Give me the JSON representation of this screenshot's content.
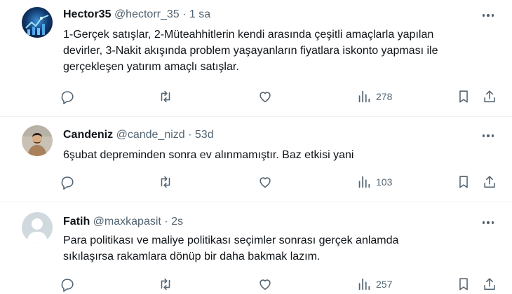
{
  "tweets": [
    {
      "name": "Hector35",
      "handle": "@hectorr_35",
      "separator": "·",
      "time": "1 sa",
      "lines": [
        "1-Gerçek satışlar, 2-Müteahhitlerin kendi arasında çeşitli amaçlarla yapılan",
        "devirler, 3-Nakit akışında problem yaşayanların fiyatlara iskonto yapması ile",
        "gerçekleşen yatırım amaçlı satışlar."
      ],
      "views": "278"
    },
    {
      "name": "Candeniz",
      "handle": "@cande_nizd",
      "separator": "·",
      "time": "53d",
      "lines": [
        "6şubat depreminden sonra ev alınmamıştır. Baz etkisi yani"
      ],
      "views": "103"
    },
    {
      "name": "Fatih",
      "handle": "@maxkapasit",
      "separator": "·",
      "time": "2s",
      "lines": [
        "Para politikası ve maliye politikası seçimler sonrası gerçek anlamda",
        "sıkılaşırsa rakamlara dönüp bir daha bakmak lazım."
      ],
      "views": "257"
    }
  ],
  "icons": {
    "reply": "reply-icon",
    "retweet": "retweet-icon",
    "like": "heart-icon",
    "views": "views-icon",
    "bookmark": "bookmark-icon",
    "share": "share-icon",
    "more": "more-icon"
  },
  "colors": {
    "text": "#0f1419",
    "secondary": "#536471",
    "divider": "#eff3f4"
  }
}
